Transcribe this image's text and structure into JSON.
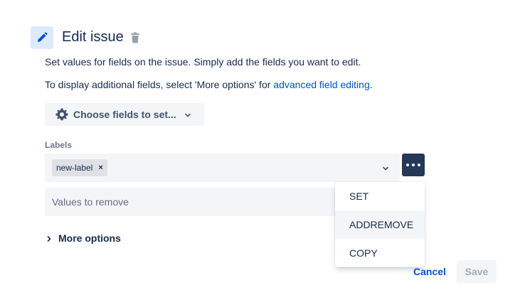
{
  "header": {
    "title": "Edit issue"
  },
  "description": {
    "line1": "Set values for fields on the issue. Simply add the fields you want to edit.",
    "line2_prefix": "To display additional fields, select 'More options' for ",
    "line2_link": "advanced field editing",
    "line2_suffix": "."
  },
  "choose_fields": {
    "label": "Choose fields to set..."
  },
  "labels_field": {
    "label": "Labels",
    "tags": [
      "new-label"
    ],
    "tag_remove_glyph": "×"
  },
  "remove_field": {
    "placeholder": "Values to remove"
  },
  "more_options": {
    "label": "More options"
  },
  "operation_menu": {
    "items": [
      "SET",
      "ADDREMOVE",
      "COPY"
    ],
    "highlighted": "ADDREMOVE"
  },
  "footer": {
    "cancel_label": "Cancel",
    "save_label": "Save"
  },
  "colors": {
    "accent": "#0052cc",
    "text": "#172b4d",
    "more_button_bg": "#253858",
    "field_bg": "#f4f5f7"
  },
  "icons": {
    "header": "pencil-icon",
    "delete": "trash-icon",
    "choose_fields": "gear-icon",
    "more": "more-icon"
  }
}
